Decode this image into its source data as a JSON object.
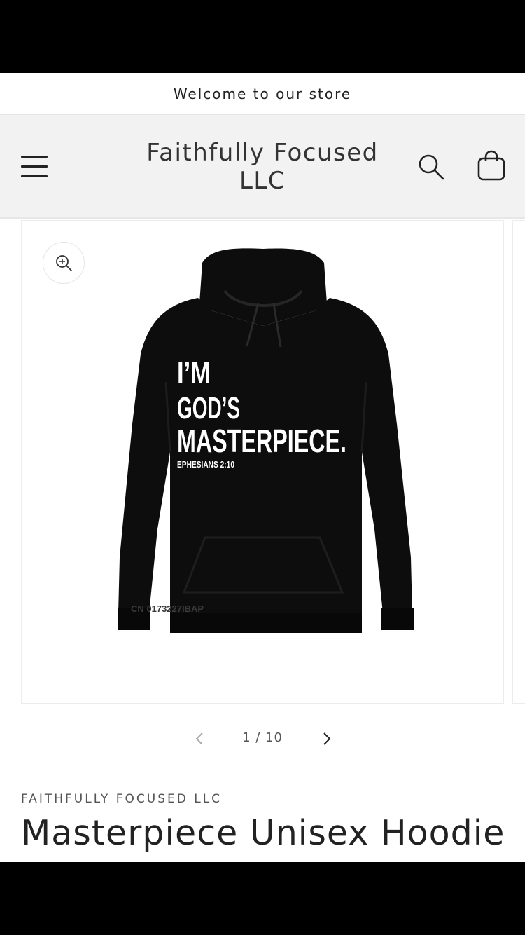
{
  "announcement": {
    "text": "Welcome to our store"
  },
  "header": {
    "brand_line1": "Faithfully Focused",
    "brand_line2": "LLC",
    "icons": {
      "menu": "hamburger-menu-icon",
      "search": "search-icon",
      "cart": "cart-icon"
    }
  },
  "gallery": {
    "zoom_icon": "zoom-in-icon",
    "image": {
      "print_line1": "I’M",
      "print_line2": "GOD’S",
      "print_line3": "MASTERPIECE.",
      "print_verse": "EPHESIANS 2:10",
      "watermark": "CN   0173227IBAP"
    },
    "pager": {
      "count": "1 / 10",
      "prev_icon": "chevron-left-icon",
      "next_icon": "chevron-right-icon"
    }
  },
  "product": {
    "vendor": "FAITHFULLY FOCUSED LLC",
    "title": "Masterpiece Unisex Hoodie"
  },
  "colors": {
    "header_bg": "#f3f2f2",
    "text": "#222222",
    "hoodie": "#0d0d0d"
  }
}
